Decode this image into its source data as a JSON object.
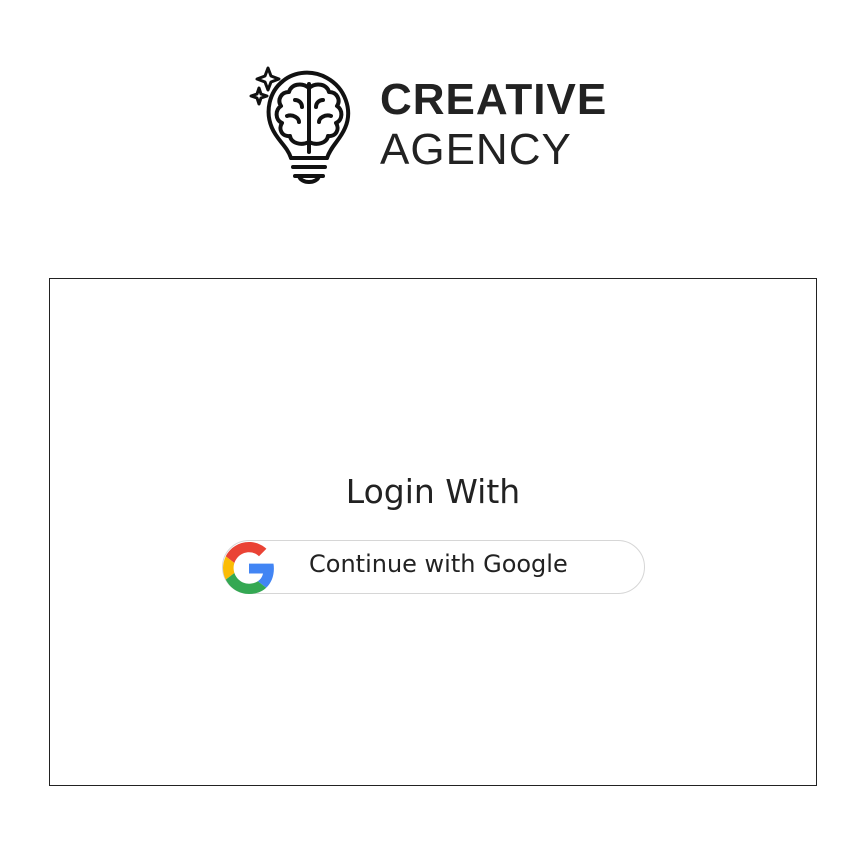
{
  "logo": {
    "line1": "CREATIVE",
    "line2": "AGENCY",
    "icon": "brain-lightbulb-icon"
  },
  "login": {
    "title": "Login With",
    "google_button_label": "Continue with Google",
    "google_icon": "google-g-icon"
  },
  "colors": {
    "text": "#222222",
    "card_border": "#222222",
    "button_border": "#d6d6d6",
    "google_blue": "#4285F4",
    "google_red": "#EA4335",
    "google_yellow": "#FBBC05",
    "google_green": "#34A853"
  }
}
